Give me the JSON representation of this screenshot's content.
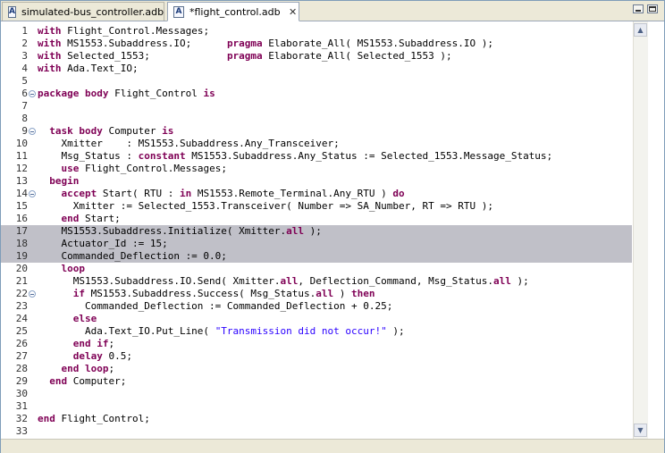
{
  "tabs": [
    {
      "label": "simulated-bus_controller.adb",
      "icon": "ada-file-icon",
      "active": false
    },
    {
      "label": "*flight_control.adb",
      "icon": "ada-file-icon",
      "active": true,
      "close": "✕"
    }
  ],
  "colors": {
    "keyword": "#7f0055",
    "string": "#2a00ff",
    "highlight": "#c0c0c8"
  },
  "highlighted_lines": [
    17,
    18,
    19
  ],
  "fold_lines": [
    6,
    9,
    14,
    22
  ],
  "lines": [
    [
      [
        "k",
        "with"
      ],
      [
        "t",
        " Flight_Control.Messages;"
      ]
    ],
    [
      [
        "k",
        "with"
      ],
      [
        "t",
        " MS1553.Subaddress.IO;      "
      ],
      [
        "k",
        "pragma"
      ],
      [
        "t",
        " Elaborate_All( MS1553.Subaddress.IO );"
      ]
    ],
    [
      [
        "k",
        "with"
      ],
      [
        "t",
        " Selected_1553;             "
      ],
      [
        "k",
        "pragma"
      ],
      [
        "t",
        " Elaborate_All( Selected_1553 );"
      ]
    ],
    [
      [
        "k",
        "with"
      ],
      [
        "t",
        " Ada.Text_IO;"
      ]
    ],
    [],
    [
      [
        "k",
        "package body"
      ],
      [
        "t",
        " Flight_Control "
      ],
      [
        "k",
        "is"
      ]
    ],
    [],
    [],
    [
      [
        "t",
        "  "
      ],
      [
        "k",
        "task body"
      ],
      [
        "t",
        " Computer "
      ],
      [
        "k",
        "is"
      ]
    ],
    [
      [
        "t",
        "    Xmitter    : MS1553.Subaddress.Any_Transceiver;"
      ]
    ],
    [
      [
        "t",
        "    Msg_Status : "
      ],
      [
        "k",
        "constant"
      ],
      [
        "t",
        " MS1553.Subaddress.Any_Status := Selected_1553.Message_Status;"
      ]
    ],
    [
      [
        "t",
        "    "
      ],
      [
        "k",
        "use"
      ],
      [
        "t",
        " Flight_Control.Messages;"
      ]
    ],
    [
      [
        "t",
        "  "
      ],
      [
        "k",
        "begin"
      ]
    ],
    [
      [
        "t",
        "    "
      ],
      [
        "k",
        "accept"
      ],
      [
        "t",
        " Start( RTU : "
      ],
      [
        "k",
        "in"
      ],
      [
        "t",
        " MS1553.Remote_Terminal.Any_RTU ) "
      ],
      [
        "k",
        "do"
      ]
    ],
    [
      [
        "t",
        "      Xmitter := Selected_1553.Transceiver( Number => SA_Number, RT => RTU );"
      ]
    ],
    [
      [
        "t",
        "    "
      ],
      [
        "k",
        "end"
      ],
      [
        "t",
        " Start;"
      ]
    ],
    [
      [
        "t",
        "    MS1553.Subaddress.Initialize( Xmitter."
      ],
      [
        "k",
        "all"
      ],
      [
        "t",
        " );"
      ]
    ],
    [
      [
        "t",
        "    Actuator_Id := 15;"
      ]
    ],
    [
      [
        "t",
        "    Commanded_Deflection := 0.0;"
      ]
    ],
    [
      [
        "t",
        "    "
      ],
      [
        "k",
        "loop"
      ]
    ],
    [
      [
        "t",
        "      MS1553.Subaddress.IO.Send( Xmitter."
      ],
      [
        "k",
        "all"
      ],
      [
        "t",
        ", Deflection_Command, Msg_Status."
      ],
      [
        "k",
        "all"
      ],
      [
        "t",
        " );"
      ]
    ],
    [
      [
        "t",
        "      "
      ],
      [
        "k",
        "if"
      ],
      [
        "t",
        " MS1553.Subaddress.Success( Msg_Status."
      ],
      [
        "k",
        "all"
      ],
      [
        "t",
        " ) "
      ],
      [
        "k",
        "then"
      ]
    ],
    [
      [
        "t",
        "        Commanded_Deflection := Commanded_Deflection + 0.25;"
      ]
    ],
    [
      [
        "t",
        "      "
      ],
      [
        "k",
        "else"
      ]
    ],
    [
      [
        "t",
        "        Ada.Text_IO.Put_Line( "
      ],
      [
        "s",
        "\"Transmission did not occur!\""
      ],
      [
        "t",
        " );"
      ]
    ],
    [
      [
        "t",
        "      "
      ],
      [
        "k",
        "end if"
      ],
      [
        "t",
        ";"
      ]
    ],
    [
      [
        "t",
        "      "
      ],
      [
        "k",
        "delay"
      ],
      [
        "t",
        " 0.5;"
      ]
    ],
    [
      [
        "t",
        "    "
      ],
      [
        "k",
        "end loop"
      ],
      [
        "t",
        ";"
      ]
    ],
    [
      [
        "t",
        "  "
      ],
      [
        "k",
        "end"
      ],
      [
        "t",
        " Computer;"
      ]
    ],
    [],
    [],
    [
      [
        "k",
        "end"
      ],
      [
        "t",
        " Flight_Control;"
      ]
    ],
    []
  ]
}
